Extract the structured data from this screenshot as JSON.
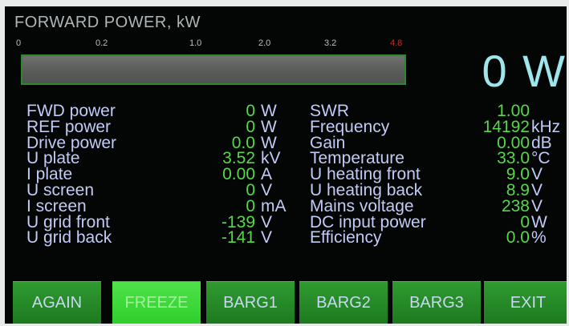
{
  "header": {
    "title": "FORWARD POWER, kW"
  },
  "meter": {
    "scale": [
      "0",
      "0.2",
      "1.0",
      "2.0",
      "3.2",
      "4.8"
    ],
    "scale_colors": {
      "normal": "#b9c0c0",
      "max": "#c0302a"
    },
    "level_fraction": 0,
    "readout": "0 W"
  },
  "left_params": [
    {
      "label": "FWD power",
      "value": "0",
      "unit": "W"
    },
    {
      "label": "REF power",
      "value": "0",
      "unit": "W"
    },
    {
      "label": "Drive power",
      "value": "0.0",
      "unit": "W"
    },
    {
      "label": "U plate",
      "value": "3.52",
      "unit": "kV"
    },
    {
      "label": "I plate",
      "value": "0.00",
      "unit": "A"
    },
    {
      "label": "U screen",
      "value": "0",
      "unit": "V"
    },
    {
      "label": "I screen",
      "value": "0",
      "unit": "mA"
    },
    {
      "label": "U grid front",
      "value": "-139",
      "unit": "V"
    },
    {
      "label": "U grid back",
      "value": "-141",
      "unit": "V"
    }
  ],
  "right_params": [
    {
      "label": "SWR",
      "value": "1.00",
      "unit": ""
    },
    {
      "label": "Frequency",
      "value": "14192",
      "unit": "kHz"
    },
    {
      "label": "Gain",
      "value": "0.00",
      "unit": "dB"
    },
    {
      "label": "Temperature",
      "value": "33.0",
      "unit": "°C"
    },
    {
      "label": "U heating front",
      "value": "9.0",
      "unit": "V"
    },
    {
      "label": "U heating back",
      "value": "8.9",
      "unit": "V"
    },
    {
      "label": "Mains voltage",
      "value": "238",
      "unit": "V"
    },
    {
      "label": "DC input power",
      "value": "0",
      "unit": "W"
    },
    {
      "label": "Efficiency",
      "value": "0.0",
      "unit": "%"
    }
  ],
  "buttons": [
    {
      "label": "AGAIN",
      "active": false
    },
    {
      "label": "FREEZE",
      "active": true
    },
    {
      "label": "BARG1",
      "active": false
    },
    {
      "label": "BARG2",
      "active": false
    },
    {
      "label": "BARG3",
      "active": false
    },
    {
      "label": "EXIT",
      "active": false
    }
  ],
  "colors": {
    "label": "#c2cbf6",
    "value": "#56d84a",
    "button": "#2a8a2b",
    "button_active": "#3fda3c"
  }
}
